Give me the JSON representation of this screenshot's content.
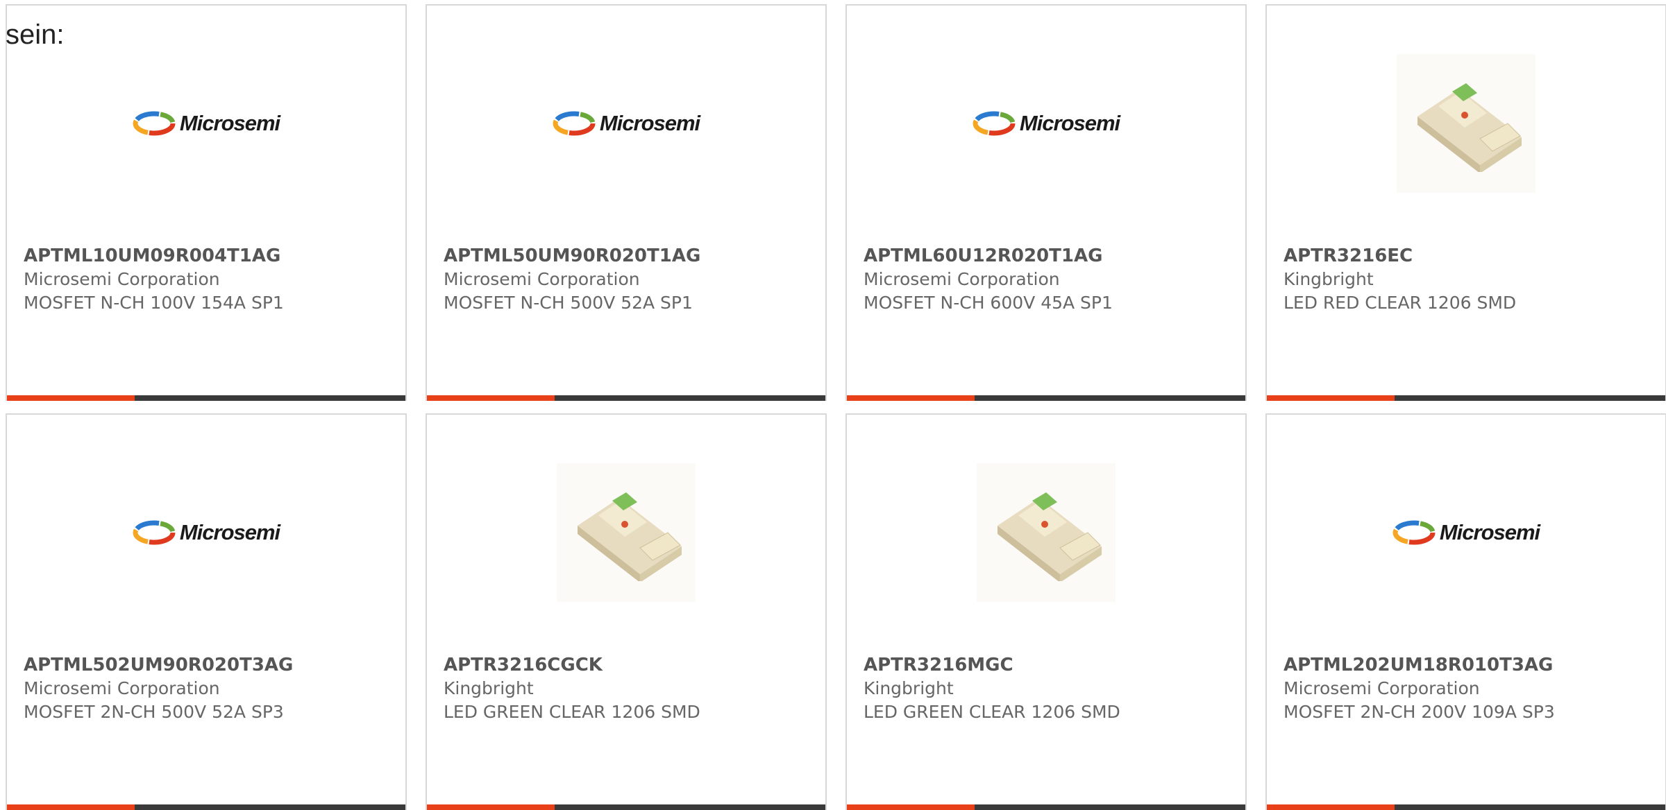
{
  "intro_text": "sein:",
  "colors": {
    "accent": "#e8411a",
    "bar": "#3a3a3a",
    "card_border": "#d8d8d8",
    "title_text": "#555555",
    "body_text": "#666666"
  },
  "logo_word": "Microsemi",
  "accent_bar_fraction": 0.32,
  "products": [
    {
      "part_number": "APTML10UM09R004T1AG",
      "manufacturer": "Microsemi Corporation",
      "description": "MOSFET N-CH 100V 154A SP1",
      "image": "microsemi-logo"
    },
    {
      "part_number": "APTML50UM90R020T1AG",
      "manufacturer": "Microsemi Corporation",
      "description": "MOSFET N-CH 500V 52A SP1",
      "image": "microsemi-logo"
    },
    {
      "part_number": "APTML60U12R020T1AG",
      "manufacturer": "Microsemi Corporation",
      "description": "MOSFET N-CH 600V 45A SP1",
      "image": "microsemi-logo"
    },
    {
      "part_number": "APTR3216EC",
      "manufacturer": "Kingbright",
      "description": "LED RED CLEAR 1206 SMD",
      "image": "smd-led-photo"
    },
    {
      "part_number": "APTML502UM90R020T3AG",
      "manufacturer": "Microsemi Corporation",
      "description": "MOSFET 2N-CH 500V 52A SP3",
      "image": "microsemi-logo"
    },
    {
      "part_number": "APTR3216CGCK",
      "manufacturer": "Kingbright",
      "description": "LED GREEN CLEAR 1206 SMD",
      "image": "smd-led-photo"
    },
    {
      "part_number": "APTR3216MGC",
      "manufacturer": "Kingbright",
      "description": "LED GREEN CLEAR 1206 SMD",
      "image": "smd-led-photo"
    },
    {
      "part_number": "APTML202UM18R010T3AG",
      "manufacturer": "Microsemi Corporation",
      "description": "MOSFET 2N-CH 200V 109A SP3",
      "image": "microsemi-logo"
    }
  ]
}
